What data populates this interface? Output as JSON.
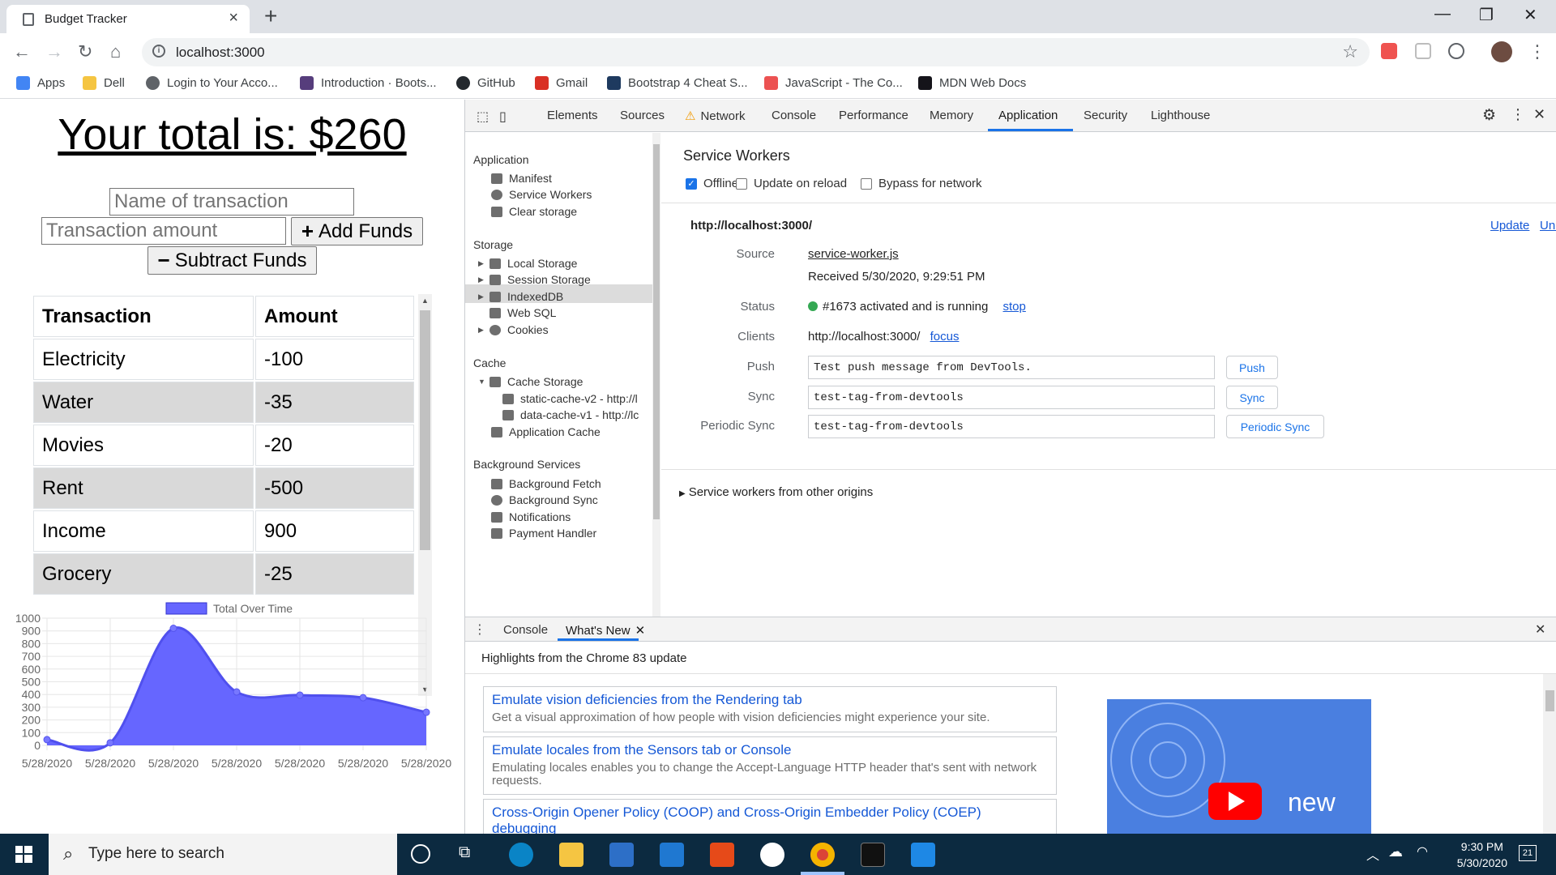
{
  "browser": {
    "tab_title": "Budget Tracker",
    "url": "localhost:3000",
    "bookmarks": [
      {
        "label": "Apps",
        "icon": "apps-grid-icon",
        "color": "#4285f4"
      },
      {
        "label": "Dell",
        "icon": "folder-icon",
        "color": "#f5c542"
      },
      {
        "label": "Login to Your Acco...",
        "icon": "globe-icon",
        "color": "#5f6368"
      },
      {
        "label": "Introduction · Boots...",
        "icon": "bootstrap-icon",
        "color": "#563d7c"
      },
      {
        "label": "GitHub",
        "icon": "github-icon",
        "color": "#24292e"
      },
      {
        "label": "Gmail",
        "icon": "gmail-icon",
        "color": "#d93025"
      },
      {
        "label": "Bootstrap 4 Cheat S...",
        "icon": "hashnode-icon",
        "color": "#1e3a5f"
      },
      {
        "label": "JavaScript - The Co...",
        "icon": "udemy-icon",
        "color": "#ec5252"
      },
      {
        "label": "MDN Web Docs",
        "icon": "mdn-icon",
        "color": "#15141a"
      }
    ]
  },
  "app": {
    "total_label": "Your total is: $260",
    "name_placeholder": "Name of transaction",
    "amount_placeholder": "Transaction amount",
    "add_label": "Add Funds",
    "subtract_label": "Subtract Funds",
    "add_glyph": "+",
    "subtract_glyph": "−",
    "table_headers": [
      "Transaction",
      "Amount"
    ],
    "transactions": [
      {
        "name": "Electricity",
        "amount": "-100"
      },
      {
        "name": "Water",
        "amount": "-35"
      },
      {
        "name": "Movies",
        "amount": "-20"
      },
      {
        "name": "Rent",
        "amount": "-500"
      },
      {
        "name": "Income",
        "amount": "900"
      },
      {
        "name": "Grocery",
        "amount": "-25"
      }
    ]
  },
  "chart_data": {
    "type": "area",
    "series": [
      {
        "name": "Total Over Time",
        "values": [
          45,
          20,
          920,
          420,
          395,
          375,
          260
        ]
      }
    ],
    "categories": [
      "5/28/2020",
      "5/28/2020",
      "5/28/2020",
      "5/28/2020",
      "5/28/2020",
      "5/28/2020",
      "5/28/2020"
    ],
    "yticks": [
      0,
      100,
      200,
      300,
      400,
      500,
      600,
      700,
      800,
      900,
      1000
    ],
    "ylim": [
      0,
      1000
    ],
    "grid": true,
    "legend": "top",
    "color": "#6666ff"
  },
  "devtools": {
    "tabs": [
      "Elements",
      "Sources",
      "Network",
      "Console",
      "Performance",
      "Memory",
      "Application",
      "Security",
      "Lighthouse"
    ],
    "active_tab": "Application",
    "sidebar": {
      "application_header": "Application",
      "application_items": [
        "Manifest",
        "Service Workers",
        "Clear storage"
      ],
      "storage_header": "Storage",
      "storage_items": [
        "Local Storage",
        "Session Storage",
        "IndexedDB",
        "Web SQL",
        "Cookies"
      ],
      "cache_header": "Cache",
      "cache_items": [
        "Cache Storage",
        "static-cache-v2 - http://l",
        "data-cache-v1 - http://lc",
        "Application Cache"
      ],
      "bg_header": "Background Services",
      "bg_items": [
        "Background Fetch",
        "Background Sync",
        "Notifications",
        "Payment Handler"
      ]
    },
    "sw": {
      "title": "Service Workers",
      "offline_label": "Offline",
      "update_on_reload_label": "Update on reload",
      "bypass_label": "Bypass for network",
      "origin": "http://localhost:3000/",
      "update_link": "Update",
      "unregister_link": "Unregister",
      "source_label": "Source",
      "source_value": "service-worker.js",
      "received": "Received 5/30/2020, 9:29:51 PM",
      "status_label": "Status",
      "status_value": "#1673 activated and is running",
      "status_color": "#34a853",
      "stop_link": "stop",
      "clients_label": "Clients",
      "clients_value": "http://localhost:3000/",
      "focus_link": "focus",
      "push_label": "Push",
      "push_value": "Test push message from DevTools.",
      "push_button": "Push",
      "sync_label": "Sync",
      "sync_value": "test-tag-from-devtools",
      "sync_button": "Sync",
      "psync_label": "Periodic Sync",
      "psync_value": "test-tag-from-devtools",
      "psync_button": "Periodic Sync",
      "others": "Service workers from other origins"
    },
    "drawer": {
      "tabs": [
        "Console",
        "What's New"
      ],
      "highlights": "Highlights from the Chrome 83 update",
      "cards": [
        {
          "title": "Emulate vision deficiencies from the Rendering tab",
          "desc": "Get a visual approximation of how people with vision deficiencies might experience your site."
        },
        {
          "title": "Emulate locales from the Sensors tab or Console",
          "desc": "Emulating locales enables you to change the Accept-Language HTTP header that's sent with network requests."
        },
        {
          "title": "Cross-Origin Opener Policy (COOP) and Cross-Origin Embedder Policy (COEP) debugging",
          "desc": ""
        }
      ],
      "video_text": "new"
    }
  },
  "taskbar": {
    "search_placeholder": "Type here to search",
    "time": "9:30 PM",
    "date": "5/30/2020",
    "notif_count": "21"
  }
}
